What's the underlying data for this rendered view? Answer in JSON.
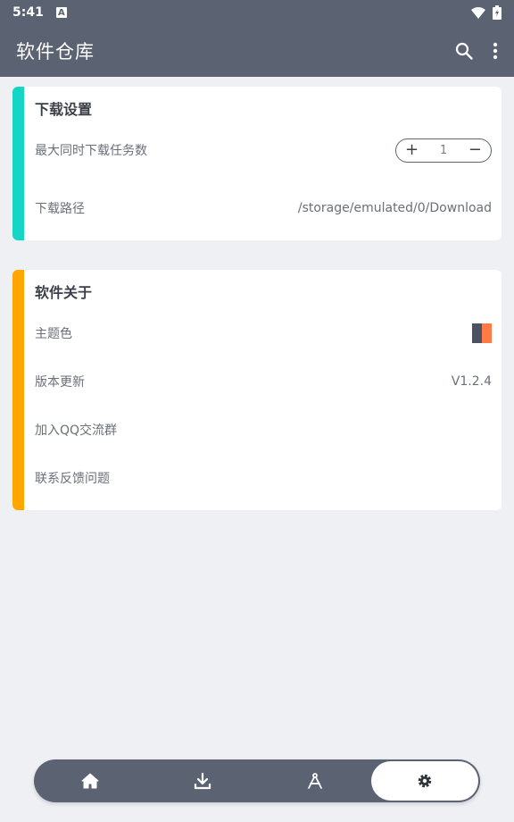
{
  "status_bar": {
    "time": "5:41",
    "a_badge": "A"
  },
  "app_bar": {
    "title": "软件仓库",
    "icons": [
      "search-icon",
      "more-vert-icon"
    ]
  },
  "download_settings": {
    "title": "下载设置",
    "accent": "#15d6c4",
    "max_tasks_label": "最大同时下载任务数",
    "max_tasks_value": "1",
    "plus": "+",
    "minus": "−",
    "path_label": "下载路径",
    "path_value": "/storage/emulated/0/Download"
  },
  "about": {
    "title": "软件关于",
    "accent": "#ffa600",
    "theme_label": "主题色",
    "theme_colors": [
      "#4a5263",
      "#ff7a45"
    ],
    "update_label": "版本更新",
    "version": "V1.2.4",
    "qq_label": "加入QQ交流群",
    "feedback_label": "联系反馈问题"
  },
  "bottom_nav": {
    "items": [
      "home-icon",
      "download-icon",
      "compass-icon",
      "settings-icon"
    ],
    "active": "settings-icon"
  },
  "colors": {
    "primary": "#5b6272",
    "background": "#eff0f4"
  }
}
